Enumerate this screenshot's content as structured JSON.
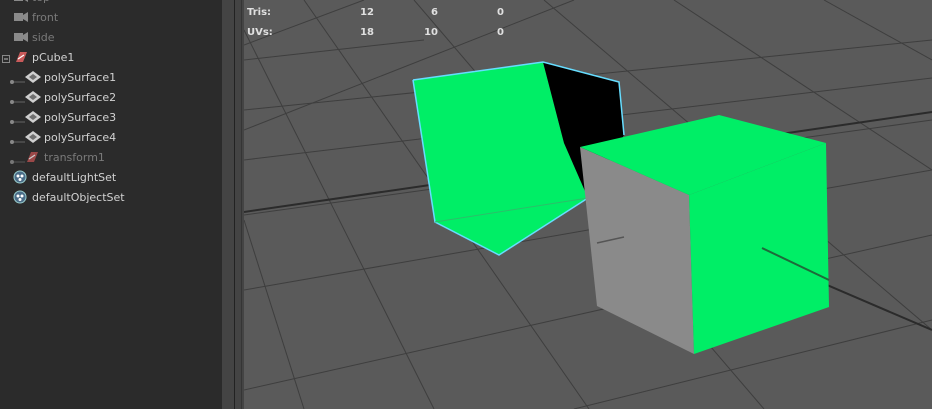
{
  "outliner": {
    "items": [
      {
        "label": "top",
        "icon": "camera-icon",
        "dim": true
      },
      {
        "label": "front",
        "icon": "camera-icon",
        "dim": true
      },
      {
        "label": "side",
        "icon": "camera-icon",
        "dim": true
      },
      {
        "label": "pCube1",
        "icon": "transform-icon",
        "dim": false
      },
      {
        "label": "polySurface1",
        "icon": "mesh-icon",
        "dim": false
      },
      {
        "label": "polySurface2",
        "icon": "mesh-icon",
        "dim": false
      },
      {
        "label": "polySurface3",
        "icon": "mesh-icon",
        "dim": false
      },
      {
        "label": "polySurface4",
        "icon": "mesh-icon",
        "dim": false
      },
      {
        "label": "transform1",
        "icon": "transform-icon",
        "dim": true
      },
      {
        "label": "defaultLightSet",
        "icon": "set-icon",
        "dim": false
      },
      {
        "label": "defaultObjectSet",
        "icon": "set-icon",
        "dim": false
      }
    ]
  },
  "hud": {
    "tris": {
      "label": "Tris:",
      "values": [
        "12",
        "6",
        "0"
      ]
    },
    "uvs": {
      "label": "UVs:",
      "values": [
        "18",
        "10",
        "0"
      ]
    }
  },
  "colors": {
    "outliner_bg": "#2b2b2b",
    "viewport_bg": "#5a5a5a",
    "mesh_green": "#00ee66",
    "selection_highlight": "#66ddff"
  }
}
